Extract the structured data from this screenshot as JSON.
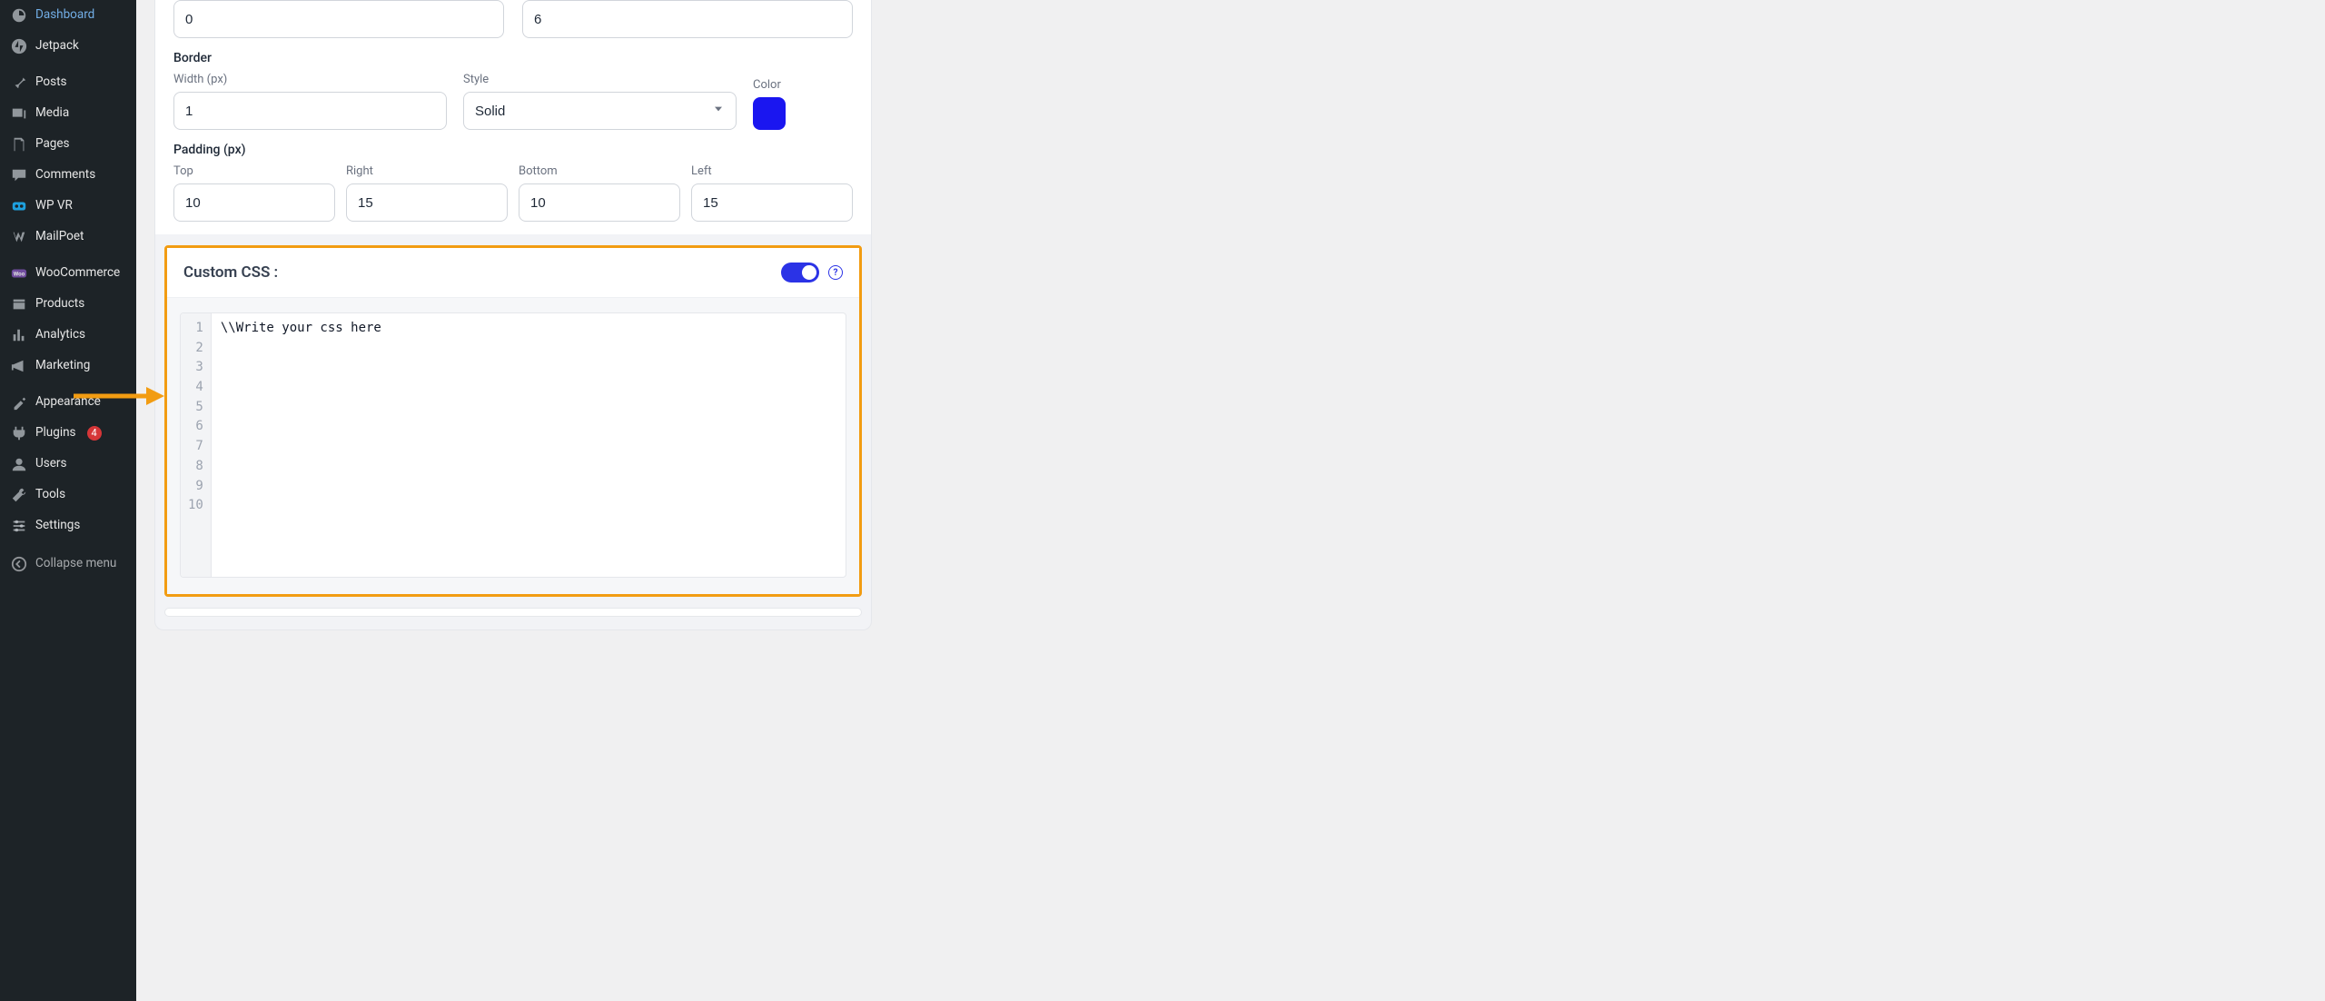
{
  "sidebar": {
    "items": [
      {
        "label": "Dashboard"
      },
      {
        "label": "Jetpack"
      },
      {
        "label": "Posts"
      },
      {
        "label": "Media"
      },
      {
        "label": "Pages"
      },
      {
        "label": "Comments"
      },
      {
        "label": "WP VR"
      },
      {
        "label": "MailPoet"
      },
      {
        "label": "WooCommerce"
      },
      {
        "label": "Products"
      },
      {
        "label": "Analytics"
      },
      {
        "label": "Marketing"
      },
      {
        "label": "Appearance"
      },
      {
        "label": "Plugins",
        "badge": "4"
      },
      {
        "label": "Users"
      },
      {
        "label": "Tools"
      },
      {
        "label": "Settings"
      }
    ],
    "collapse_label": "Collapse menu"
  },
  "panel": {
    "top_inputs": {
      "left_value": "0",
      "right_value": "6"
    },
    "border": {
      "section_label": "Border",
      "width_label": "Width (px)",
      "width_value": "1",
      "style_label": "Style",
      "style_value": "Solid",
      "color_label": "Color",
      "color_hex": "#1a16f0"
    },
    "padding": {
      "section_label": "Padding (px)",
      "top_label": "Top",
      "top_value": "10",
      "right_label": "Right",
      "right_value": "15",
      "bottom_label": "Bottom",
      "bottom_value": "10",
      "left_label": "Left",
      "left_value": "15"
    },
    "custom_css": {
      "title": "Custom CSS :",
      "enabled": true,
      "line_count": 10,
      "content": "\\\\Write your css here"
    }
  },
  "colors": {
    "highlight": "#f29c12",
    "sidebar_bg": "#1d2327",
    "toggle_on": "#2b33e6"
  }
}
